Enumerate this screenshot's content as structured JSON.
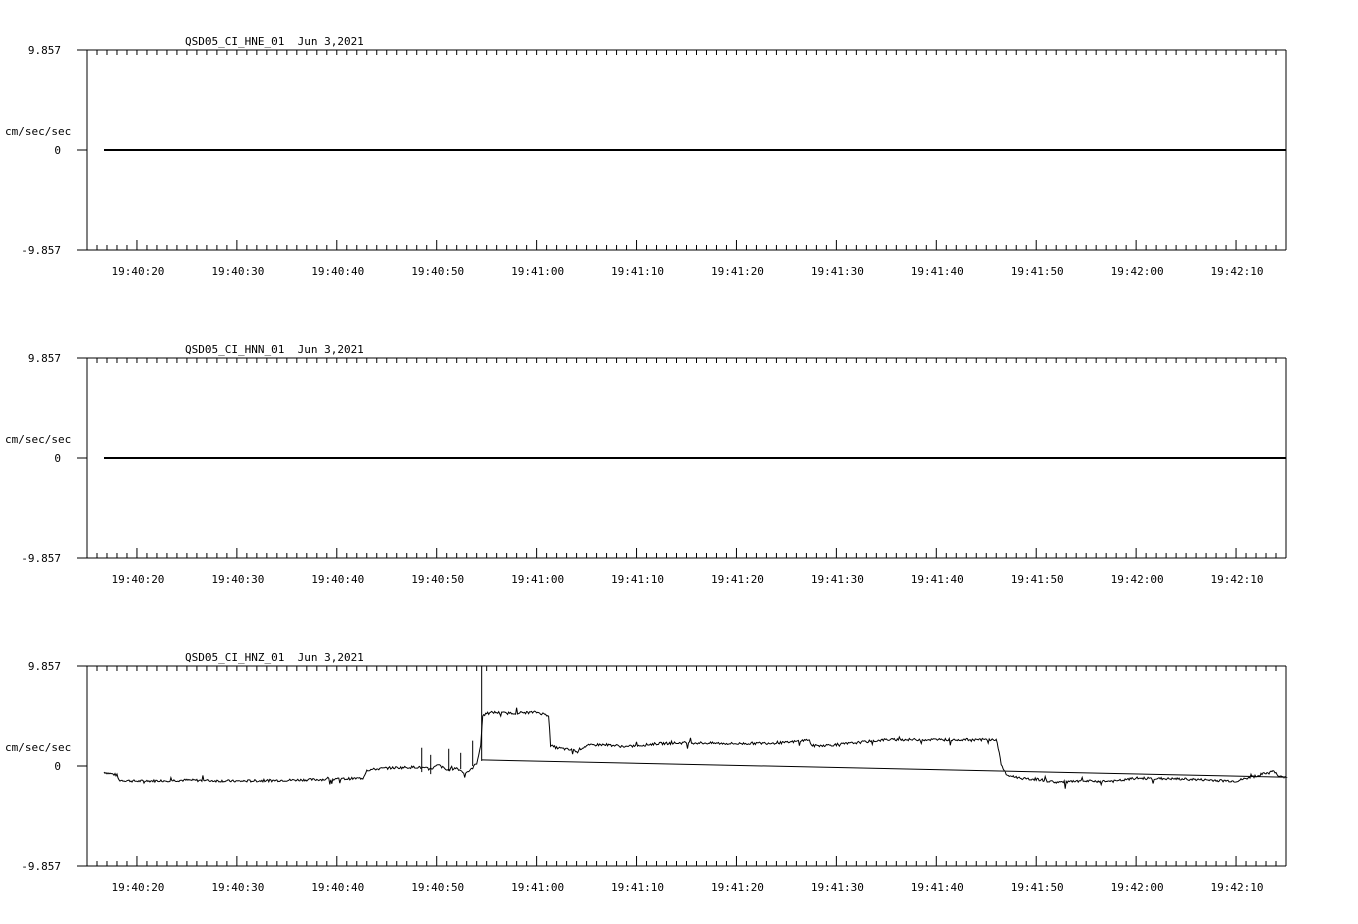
{
  "chart_data": [
    {
      "type": "line",
      "title": "QSD05_CI_HNE_01  Jun 3,2021",
      "ylabel": "cm/sec/sec",
      "ylim": [
        -9.857,
        9.857
      ],
      "ytick_labels": [
        "9.857",
        "0",
        "-9.857"
      ],
      "xlim": [
        "19:40:15",
        "19:42:15"
      ],
      "xtick_labels": [
        "19:40:20",
        "19:40:30",
        "19:40:40",
        "19:40:50",
        "19:41:00",
        "19:41:10",
        "19:41:20",
        "19:41:30",
        "19:41:40",
        "19:41:50",
        "19:42:00",
        "19:42:10"
      ],
      "series": [
        {
          "t": [
            1.7,
            120
          ],
          "y": [
            0,
            0
          ]
        }
      ]
    },
    {
      "type": "line",
      "title": "QSD05_CI_HNN_01  Jun 3,2021",
      "ylabel": "cm/sec/sec",
      "ylim": [
        -9.857,
        9.857
      ],
      "ytick_labels": [
        "9.857",
        "0",
        "-9.857"
      ],
      "xlim": [
        "19:40:15",
        "19:42:15"
      ],
      "xtick_labels": [
        "19:40:20",
        "19:40:30",
        "19:40:40",
        "19:40:50",
        "19:41:00",
        "19:41:10",
        "19:41:20",
        "19:41:30",
        "19:41:40",
        "19:41:50",
        "19:42:00",
        "19:42:10"
      ],
      "series": [
        {
          "t": [
            1.7,
            120
          ],
          "y": [
            0,
            0
          ]
        }
      ]
    },
    {
      "type": "line",
      "title": "QSD05_CI_HNZ_01  Jun 3,2021",
      "ylabel": "cm/sec/sec",
      "ylim": [
        -9.857,
        9.857
      ],
      "ytick_labels": [
        "9.857",
        "0",
        "-9.857"
      ],
      "xlim": [
        "19:40:15",
        "19:42:15"
      ],
      "xtick_labels": [
        "19:40:20",
        "19:40:30",
        "19:40:40",
        "19:40:50",
        "19:41:00",
        "19:41:10",
        "19:41:20",
        "19:41:30",
        "19:41:40",
        "19:41:50",
        "19:42:00",
        "19:42:10"
      ],
      "series": [
        {
          "t": [
            1.7,
            3.0,
            3.2,
            5,
            10,
            15,
            20,
            25,
            27.6,
            28.0,
            30,
            33,
            34.4,
            35.2,
            36.0,
            37.0,
            37.8,
            38.4,
            39.0,
            39.4,
            39.6,
            40.6,
            42,
            45,
            46.2,
            46.4,
            47,
            49,
            50,
            51,
            52,
            54,
            55,
            57,
            60,
            65,
            70,
            72.3,
            72.5,
            73,
            75,
            80,
            85,
            91,
            91.2,
            91.5,
            92,
            94,
            95,
            97,
            100,
            103,
            105,
            110,
            115,
            118.8,
            119.2,
            120
          ],
          "y": [
            -0.6,
            -0.9,
            -1.4,
            -1.5,
            -1.4,
            -1.5,
            -1.4,
            -1.3,
            -1.2,
            -0.4,
            -0.2,
            -0.1,
            -0.3,
            0.1,
            -0.4,
            -0.2,
            -0.7,
            -0.4,
            0.3,
            2.0,
            5.0,
            5.3,
            5.2,
            5.3,
            5.0,
            2.0,
            1.8,
            1.5,
            2.0,
            2.1,
            2.1,
            1.9,
            2.0,
            2.2,
            2.3,
            2.2,
            2.3,
            2.6,
            2.0,
            2.0,
            2.1,
            2.6,
            2.6,
            2.6,
            1.8,
            0.2,
            -0.9,
            -1.3,
            -1.3,
            -1.6,
            -1.5,
            -1.5,
            -1.2,
            -1.3,
            -1.5,
            -0.5,
            -1.0,
            -1.1
          ]
        }
      ]
    }
  ]
}
